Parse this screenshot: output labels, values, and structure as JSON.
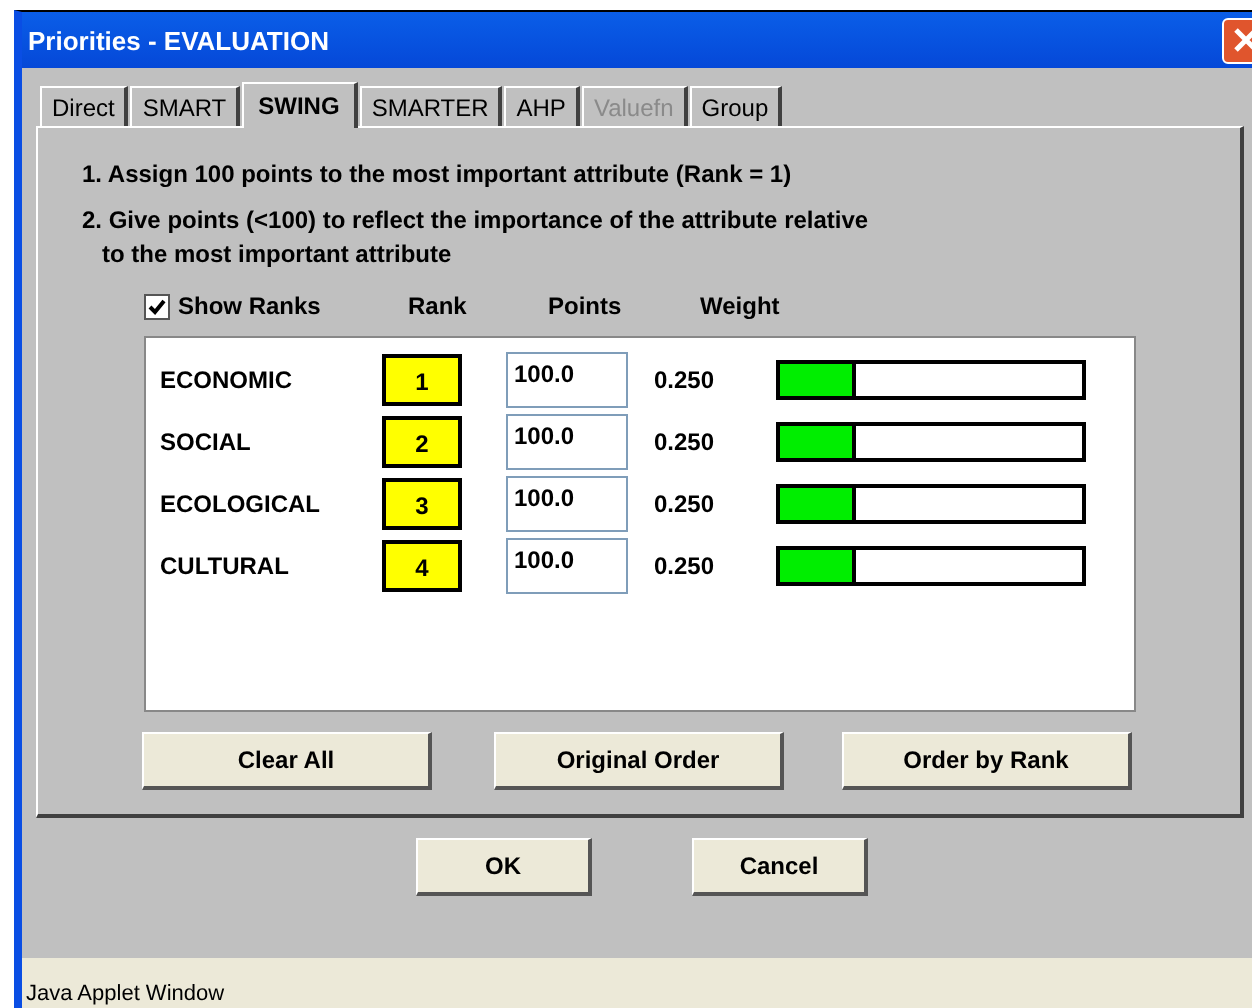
{
  "window": {
    "title": "Priorities - EVALUATION"
  },
  "tabs": [
    {
      "label": "Direct",
      "selected": false,
      "disabled": false
    },
    {
      "label": "SMART",
      "selected": false,
      "disabled": false
    },
    {
      "label": "SWING",
      "selected": true,
      "disabled": false
    },
    {
      "label": "SMARTER",
      "selected": false,
      "disabled": false
    },
    {
      "label": "AHP",
      "selected": false,
      "disabled": false
    },
    {
      "label": "Valuefn",
      "selected": false,
      "disabled": true
    },
    {
      "label": "Group",
      "selected": false,
      "disabled": false
    }
  ],
  "instructions": [
    "1. Assign 100 points to the most important attribute (Rank = 1)",
    "2. Give points (<100) to reflect the importance of the attribute relative",
    "to the most important attribute"
  ],
  "show_ranks": {
    "label": "Show Ranks",
    "checked": true
  },
  "columns": [
    "Rank",
    "Points",
    "Weight"
  ],
  "attributes": [
    {
      "name": "ECONOMIC",
      "rank": "1",
      "points": "100.0",
      "weight": "0.250",
      "level": 0.25
    },
    {
      "name": "SOCIAL",
      "rank": "2",
      "points": "100.0",
      "weight": "0.250",
      "level": 0.25
    },
    {
      "name": "ECOLOGICAL",
      "rank": "3",
      "points": "100.0",
      "weight": "0.250",
      "level": 0.25
    },
    {
      "name": "CULTURAL",
      "rank": "4",
      "points": "100.0",
      "weight": "0.250",
      "level": 0.25
    }
  ],
  "panel_buttons": [
    "Clear All",
    "Original Order",
    "Order by Rank"
  ],
  "dialog_buttons": [
    "OK",
    "Cancel"
  ],
  "status_bar": "Java Applet Window"
}
